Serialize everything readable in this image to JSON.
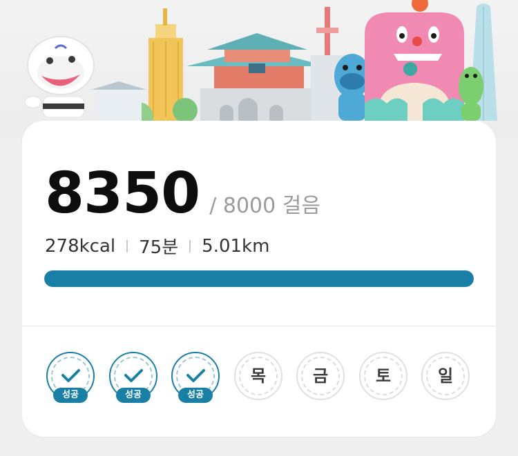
{
  "steps": {
    "current": "8350",
    "goal_text": "/ 8000 걸음",
    "progress": 1.0
  },
  "stats": {
    "calories": "278kcal",
    "minutes": "75분",
    "distance": "5.01km"
  },
  "week": [
    {
      "status": "done",
      "badge": "성공"
    },
    {
      "status": "done",
      "badge": "성공"
    },
    {
      "status": "done",
      "badge": "성공"
    },
    {
      "status": "pending",
      "label": "목"
    },
    {
      "status": "pending",
      "label": "금"
    },
    {
      "status": "pending",
      "label": "토"
    },
    {
      "status": "pending",
      "label": "일"
    }
  ],
  "colors": {
    "accent": "#1a7fa5",
    "mascot_pink": "#f08ab3",
    "mascot_blue": "#4fa9d6",
    "mascot_green": "#7ccf6e"
  },
  "illustration": {
    "icons": [
      "white-tiger-mascot-icon",
      "tower-icon",
      "palace-gate-icon",
      "blue-mascot-icon",
      "pink-monster-mascot-icon",
      "green-mascot-icon",
      "skyscraper-icon"
    ]
  }
}
